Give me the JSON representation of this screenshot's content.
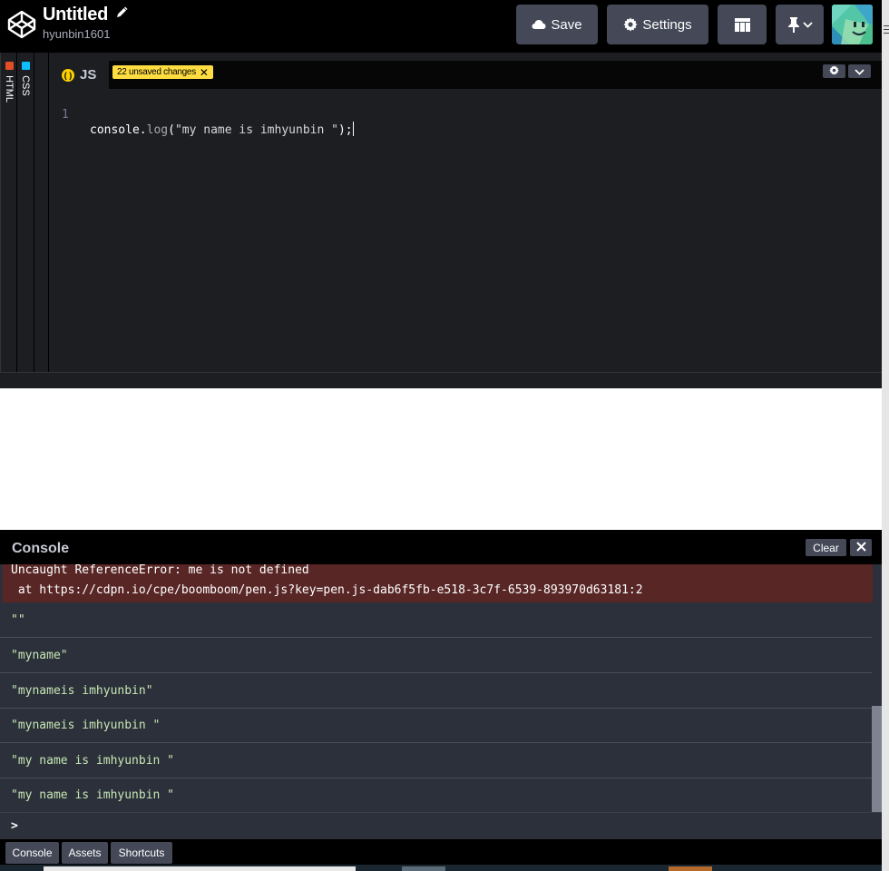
{
  "header": {
    "title": "Untitled",
    "username": "hyunbin1601",
    "save_label": "Save",
    "settings_label": "Settings",
    "icons": [
      "codepen-logo-icon",
      "pencil-icon",
      "cloud-icon",
      "gear-icon",
      "layout-icon",
      "pin-icon",
      "chevron-down-icon",
      "avatar"
    ]
  },
  "sidebar": {
    "tabs": [
      {
        "label": "HTML",
        "color": "#e44d26"
      },
      {
        "label": "CSS",
        "color": "#0ebeff"
      }
    ]
  },
  "editor": {
    "tab_label": "JS",
    "tab_icon_text": "( )",
    "unsaved_label": "22 unsaved changes",
    "line_number": "1",
    "code_object": "console",
    "code_dot": ".",
    "code_fn": "log",
    "code_open": "(",
    "code_string": "\"my name is imhyunbin \"",
    "code_close": ");"
  },
  "console": {
    "title": "Console",
    "clear_label": "Clear",
    "error_line1": "Uncaught ReferenceError: me is not defined",
    "error_line2": " at https://cdpn.io/cpe/boomboom/pen.js?key=pen.js-dab6f5fb-e518-3c7f-6539-893970d63181:2",
    "entries": [
      "\"\"",
      "\"myname\"",
      "\"mynameis imhyunbin\"",
      "\"mynameis imhyunbin \"",
      "\"my name is imhyunbin \"",
      "\"my name is imhyunbin \""
    ],
    "prompt": ">"
  },
  "footer": {
    "console_label": "Console",
    "assets_label": "Assets",
    "shortcuts_label": "Shortcuts"
  },
  "colors": {
    "header_bg": "#000000",
    "button_bg": "#444857",
    "editor_bg": "#1d1e22",
    "console_bg": "#2c303a",
    "error_bg": "#592626",
    "unsaved_badge": "#ffdd40",
    "js_icon": "#fcd000"
  }
}
